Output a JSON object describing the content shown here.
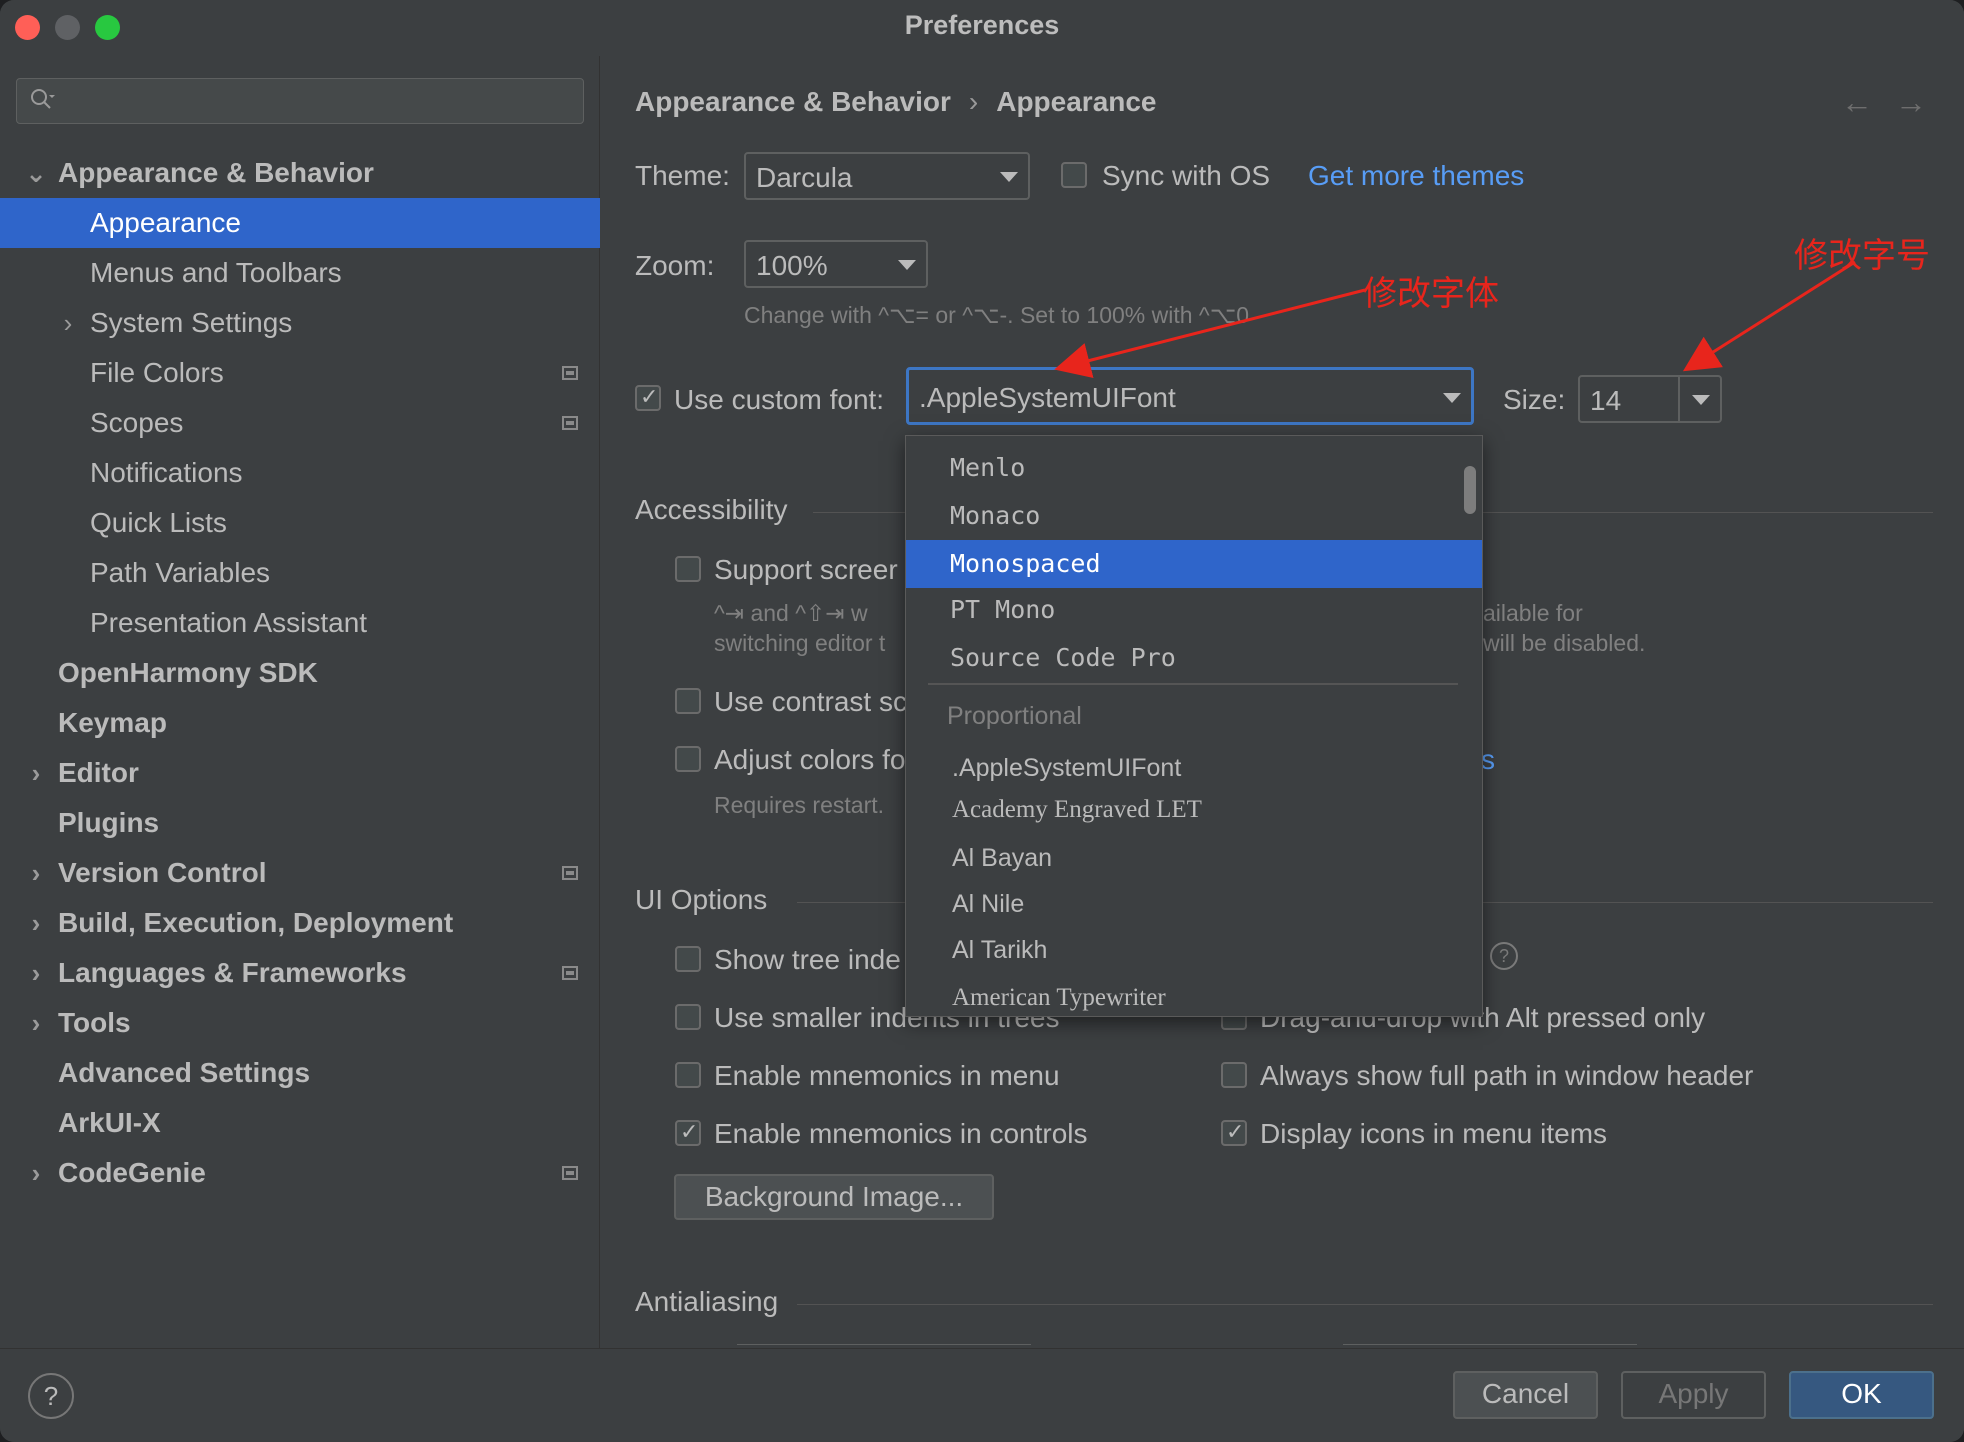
{
  "window": {
    "title": "Preferences"
  },
  "sidebar": {
    "search": {
      "placeholder": ""
    },
    "items": [
      {
        "label": "Appearance & Behavior",
        "level": 0,
        "bold": true,
        "chevron": "expanded"
      },
      {
        "label": "Appearance",
        "level": 1,
        "selected": true
      },
      {
        "label": "Menus and Toolbars",
        "level": 1
      },
      {
        "label": "System Settings",
        "level": 1,
        "chevron": "collapsed"
      },
      {
        "label": "File Colors",
        "level": 1,
        "badge": true
      },
      {
        "label": "Scopes",
        "level": 1,
        "badge": true
      },
      {
        "label": "Notifications",
        "level": 1
      },
      {
        "label": "Quick Lists",
        "level": 1
      },
      {
        "label": "Path Variables",
        "level": 1
      },
      {
        "label": "Presentation Assistant",
        "level": 1
      },
      {
        "label": "OpenHarmony SDK",
        "level": 0,
        "bold": true
      },
      {
        "label": "Keymap",
        "level": 0,
        "bold": true
      },
      {
        "label": "Editor",
        "level": 0,
        "bold": true,
        "chevron": "collapsed"
      },
      {
        "label": "Plugins",
        "level": 0,
        "bold": true
      },
      {
        "label": "Version Control",
        "level": 0,
        "bold": true,
        "chevron": "collapsed",
        "badge": true
      },
      {
        "label": "Build, Execution, Deployment",
        "level": 0,
        "bold": true,
        "chevron": "collapsed"
      },
      {
        "label": "Languages & Frameworks",
        "level": 0,
        "bold": true,
        "chevron": "collapsed",
        "badge": true
      },
      {
        "label": "Tools",
        "level": 0,
        "bold": true,
        "chevron": "collapsed"
      },
      {
        "label": "Advanced Settings",
        "level": 0,
        "bold": true
      },
      {
        "label": "ArkUI-X",
        "level": 0,
        "bold": true
      },
      {
        "label": "CodeGenie",
        "level": 0,
        "bold": true,
        "chevron": "collapsed",
        "badge": true
      }
    ]
  },
  "main": {
    "breadcrumb": {
      "parent": "Appearance & Behavior",
      "separator": "›",
      "current": "Appearance"
    },
    "theme": {
      "label": "Theme:",
      "value": "Darcula",
      "sync_label": "Sync with OS",
      "sync_checked": false,
      "more_link": "Get more themes"
    },
    "zoom": {
      "label": "Zoom:",
      "value": "100%",
      "hint": "Change with ^⌥= or ^⌥-. Set to 100% with ^⌥0"
    },
    "font": {
      "checkbox_label": "Use custom font:",
      "checked": true,
      "value": ".AppleSystemUIFont",
      "size_label": "Size:",
      "size_value": "14"
    },
    "accessibility": {
      "title": "Accessibility",
      "support_screen_label": "Support screer",
      "support_screen_hint1": "^⇥ and ^⇧⇥ w",
      "support_screen_hint2": "switching editor t",
      "support_hint_right1": "ailable for",
      "support_hint_right2": "will be disabled.",
      "contrast_label": "Use contrast sc",
      "adjust_label": "Adjust colors fo",
      "adjust_hint": "Requires restart.",
      "adjust_link_tail": "s"
    },
    "ui_options": {
      "title": "UI Options",
      "show_tree_label": "Show tree inde",
      "smaller_indents_label": "Use smaller indents in trees",
      "drag_drop_label": "Drag-and-drop with Alt pressed only",
      "mnemonics_menu_label": "Enable mnemonics in menu",
      "full_path_label": "Always show full path in window header",
      "mnemonics_controls_label": "Enable mnemonics in controls",
      "mnemonics_controls_checked": true,
      "display_icons_label": "Display icons in menu items",
      "display_icons_checked": true,
      "background_button": "Background Image..."
    },
    "antialiasing": {
      "title": "Antialiasing"
    }
  },
  "font_popup": {
    "monospaced": [
      "Menlo",
      "Monaco",
      "Monospaced",
      "PT Mono",
      "Source Code Pro"
    ],
    "selected": "Monospaced",
    "group_label": "Proportional",
    "proportional": [
      ".AppleSystemUIFont",
      "Academy Engraved LET",
      "Al Bayan",
      "Al Nile",
      "Al Tarikh",
      "American Typewriter"
    ]
  },
  "footer": {
    "cancel": "Cancel",
    "apply": "Apply",
    "ok": "OK"
  },
  "annotations": {
    "font_note": "修改字体",
    "size_note": "修改字号",
    "color": "#e8251c"
  }
}
